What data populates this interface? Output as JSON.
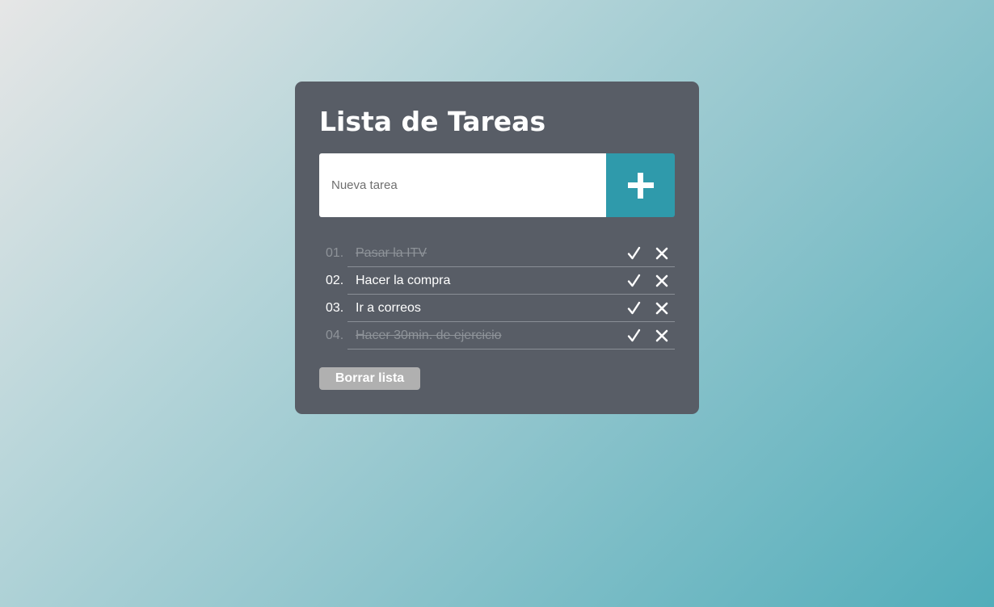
{
  "app": {
    "title": "Lista de Tareas"
  },
  "new_task": {
    "placeholder": "Nueva tarea",
    "value": ""
  },
  "tasks": [
    {
      "number": "01.",
      "text": "Pasar la ITV",
      "done": true
    },
    {
      "number": "02.",
      "text": "Hacer la compra",
      "done": false
    },
    {
      "number": "03.",
      "text": "Ir a correos",
      "done": false
    },
    {
      "number": "04.",
      "text": "Hacer 30min. de ejercicio",
      "done": true
    }
  ],
  "clear_button": {
    "label": "Borrar lista"
  },
  "icons": {
    "add": "plus-icon",
    "complete": "checkmark-icon",
    "delete": "close-icon"
  },
  "colors": {
    "card_background": "#585d66",
    "add_button": "#2f9aab",
    "clear_button": "#b0b0b0",
    "done_text": "#8e9399"
  }
}
